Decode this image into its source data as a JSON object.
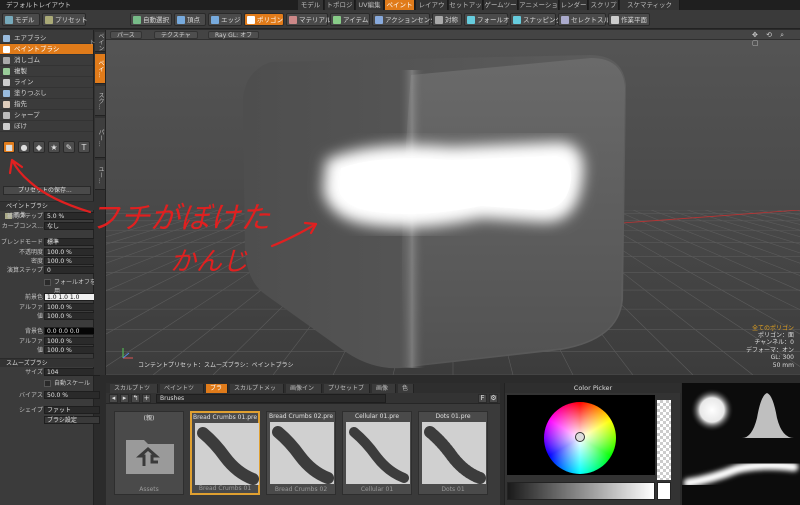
{
  "layout_menu": "デフォルトレイアウト",
  "layout_tabs": [
    {
      "label": "モデル"
    },
    {
      "label": "トポロジ"
    },
    {
      "label": "UV編集"
    },
    {
      "label": "ペイント",
      "active": true
    },
    {
      "label": "レイアウト"
    },
    {
      "label": "セットアップ"
    },
    {
      "label": "ゲームツール"
    },
    {
      "label": "アニメーション"
    },
    {
      "label": "レンダー"
    },
    {
      "label": "スクリプト"
    },
    {
      "label": "スケマティックFusion"
    }
  ],
  "toolbar": {
    "items": [
      {
        "label": "モデル",
        "icon": "cube-icon"
      },
      {
        "label": "プリセット",
        "icon": "preset-icon"
      },
      {
        "label": "自動選択",
        "icon": "auto-select-icon"
      },
      {
        "label": "頂点",
        "icon": "vertex-icon"
      },
      {
        "label": "エッジ",
        "icon": "edge-icon"
      },
      {
        "label": "ポリゴン",
        "icon": "polygon-icon",
        "selected": true
      },
      {
        "label": "マテリアル",
        "icon": "material-icon"
      },
      {
        "label": "アイテム",
        "icon": "item-icon"
      },
      {
        "label": "アクションセンター",
        "icon": "action-center-icon"
      },
      {
        "label": "対称",
        "icon": "symmetry-icon"
      },
      {
        "label": "フォールオフ",
        "icon": "falloff-icon"
      },
      {
        "label": "スナッピング",
        "icon": "snapping-icon"
      },
      {
        "label": "セレクトスルー",
        "icon": "select-through-icon"
      },
      {
        "label": "作業平面",
        "icon": "workplane-icon"
      }
    ]
  },
  "paint_tools": [
    {
      "label": "エアブラシ"
    },
    {
      "label": "ペイントブラシ",
      "active": true
    },
    {
      "label": "消しゴム"
    },
    {
      "label": "複製"
    },
    {
      "label": "ライン"
    },
    {
      "label": "塗りつぶし"
    },
    {
      "label": "指先"
    },
    {
      "label": "シャープ"
    },
    {
      "label": "ぼけ"
    }
  ],
  "shapes": [
    "■",
    "●",
    "◆",
    "★",
    "✎",
    "T"
  ],
  "preset_save": "プリセットの保存...",
  "mini_items": [
    "ブ",
    "画像"
  ],
  "vertical_tabs": [
    "ペイント",
    "ペイ...",
    "スク...",
    "パー...",
    "ユー..."
  ],
  "properties": {
    "section_paint_brush": "ペイントブラシ",
    "spacing_label": "補間ステップ",
    "spacing_value": "5.0 %",
    "curve_label": "カーブコンス...",
    "curve_value": "なし",
    "blend_label": "ブレンドモード",
    "blend_value": "標準",
    "opacity_label": "不透明度",
    "opacity_value": "100.0 %",
    "density_label": "密度",
    "density_value": "100.0 %",
    "step_label": "演算ステップ",
    "step_value": "0",
    "falloff_check": "フォールオフを使用",
    "fg_label": "前景色",
    "fg_value": "1.0   1.0   1.0",
    "fg_alpha_label": "アルファ",
    "fg_alpha_value": "100.0 %",
    "fg_value_label": "値",
    "fg_value2": "100.0 %",
    "bg_label": "背景色",
    "bg_value": "0.0   0.0   0.0",
    "bg_alpha_label": "アルファ",
    "bg_alpha_value": "100.0 %",
    "bg_value_label": "値",
    "bg_value2": "100.0 %",
    "section_smooth": "スムーズブラシ",
    "size_label": "サイズ",
    "size_value": "104",
    "autoscale_check": "自動スケール",
    "bias_label": "バイアス",
    "bias_value": "50.0 %",
    "shape_label": "シェイプ",
    "shape_value": "ファット",
    "brush_settings": "ブラシ設定"
  },
  "viewport": {
    "tabs": [
      "パース",
      "テクスチャ",
      "Ray GL: オフ"
    ],
    "preset_text": "コンテントプリセット：スムーズブラシ：ペイントブラシ",
    "stats": {
      "title": "全てのポリゴン",
      "lines": [
        "ポリゴン：面",
        "チャンネル：0",
        "デフォーマ：オン",
        "GL: 300",
        "50 mm"
      ]
    }
  },
  "annotation": {
    "line1": "フチがぼけた",
    "line2": "かんじ",
    "color": "#e02020"
  },
  "dock_tabs": [
    {
      "label": "スカルプトツール"
    },
    {
      "label": "ペイントツール"
    },
    {
      "label": "ブラシ",
      "active": true
    },
    {
      "label": "スカルプトメッシュ"
    },
    {
      "label": "画像インク"
    },
    {
      "label": "プリセットブラシ"
    },
    {
      "label": "画像"
    },
    {
      "label": "色"
    }
  ],
  "browser": {
    "path": "Brushes",
    "items": [
      {
        "name": "(親)",
        "caption": "Assets",
        "type": "folder"
      },
      {
        "name": "Bread Crumbs 01.pre",
        "caption": "Bread Crumbs 01",
        "selected": true
      },
      {
        "name": "Bread Crumbs 02.pre",
        "caption": "Bread Crumbs 02"
      },
      {
        "name": "Cellular 01.pre",
        "caption": "Cellular 01"
      },
      {
        "name": "Dots 01.pre",
        "caption": "Dots 01"
      }
    ]
  },
  "color_picker_title": "Color Picker"
}
